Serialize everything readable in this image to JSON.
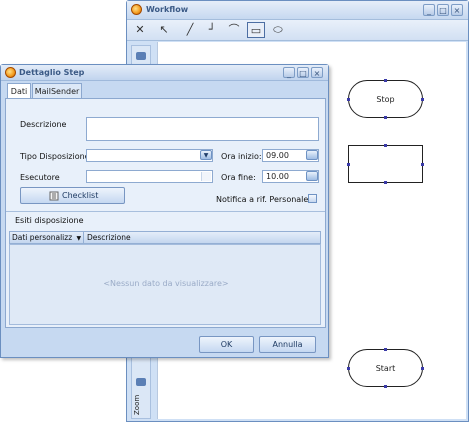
{
  "workflow": {
    "title": "Workflow",
    "toolbar": {
      "tools": [
        {
          "name": "close-x",
          "glyph": "✕"
        },
        {
          "name": "pointer",
          "glyph": "↖"
        },
        {
          "name": "line",
          "glyph": "╱"
        },
        {
          "name": "elbow",
          "glyph": "┘"
        },
        {
          "name": "curve",
          "glyph": "⌒"
        },
        {
          "name": "rectangle",
          "glyph": "▭"
        },
        {
          "name": "ellipse",
          "glyph": "⬭"
        }
      ]
    },
    "sidebar_label": "Zoom",
    "nodes": {
      "stop": "Stop",
      "start": "Start",
      "step": ""
    },
    "caption_buttons": {
      "minimize": "_",
      "maximize": "□",
      "close": "×"
    }
  },
  "dialog": {
    "title": "Dettaglio Step",
    "tabs": [
      "Dati",
      "MailSender"
    ],
    "fields": {
      "descrizione_label": "Descrizione",
      "descrizione_value": "",
      "tipo_disposizione_label": "Tipo Disposizione",
      "tipo_disposizione_value": "",
      "esecutore_label": "Esecutore",
      "esecutore_value": "",
      "ora_inizio_label": "Ora inizio:",
      "ora_inizio_value": "09.00",
      "ora_fine_label": "Ora fine:",
      "ora_fine_value": "10.00",
      "notifica_label": "Notifica a rif. Personale",
      "notifica_checked": false
    },
    "checklist_button": "Checklist",
    "esiti": {
      "section_label": "Esiti disposizione",
      "columns": [
        "Dati personalizz",
        "Descrizione"
      ],
      "empty_text": "<Nessun dato da visualizzare>"
    },
    "ok_button": "OK",
    "cancel_button": "Annulla",
    "caption_buttons": {
      "minimize": "_",
      "maximize": "□",
      "close": "×"
    }
  }
}
